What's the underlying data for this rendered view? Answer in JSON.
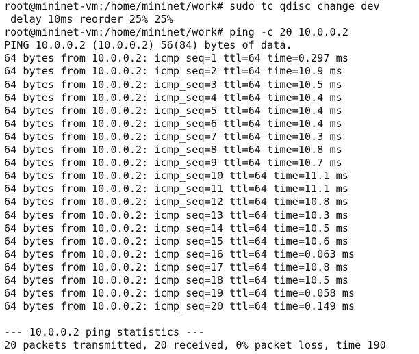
{
  "terminal": {
    "lines": [
      "root@mininet-vm:/home/mininet/work# sudo tc qdisc change dev",
      " delay 10ms reorder 25% 25%",
      "root@mininet-vm:/home/mininet/work# ping -c 20 10.0.0.2",
      "PING 10.0.0.2 (10.0.0.2) 56(84) bytes of data.",
      "64 bytes from 10.0.0.2: icmp_seq=1 ttl=64 time=0.297 ms",
      "64 bytes from 10.0.0.2: icmp_seq=2 ttl=64 time=10.9 ms",
      "64 bytes from 10.0.0.2: icmp_seq=3 ttl=64 time=10.5 ms",
      "64 bytes from 10.0.0.2: icmp_seq=4 ttl=64 time=10.4 ms",
      "64 bytes from 10.0.0.2: icmp_seq=5 ttl=64 time=10.4 ms",
      "64 bytes from 10.0.0.2: icmp_seq=6 ttl=64 time=10.4 ms",
      "64 bytes from 10.0.0.2: icmp_seq=7 ttl=64 time=10.3 ms",
      "64 bytes from 10.0.0.2: icmp_seq=8 ttl=64 time=10.8 ms",
      "64 bytes from 10.0.0.2: icmp_seq=9 ttl=64 time=10.7 ms",
      "64 bytes from 10.0.0.2: icmp_seq=10 ttl=64 time=11.1 ms",
      "64 bytes from 10.0.0.2: icmp_seq=11 ttl=64 time=11.1 ms",
      "64 bytes from 10.0.0.2: icmp_seq=12 ttl=64 time=10.8 ms",
      "64 bytes from 10.0.0.2: icmp_seq=13 ttl=64 time=10.3 ms",
      "64 bytes from 10.0.0.2: icmp_seq=14 ttl=64 time=10.5 ms",
      "64 bytes from 10.0.0.2: icmp_seq=15 ttl=64 time=10.6 ms",
      "64 bytes from 10.0.0.2: icmp_seq=16 ttl=64 time=0.063 ms",
      "64 bytes from 10.0.0.2: icmp_seq=17 ttl=64 time=10.8 ms",
      "64 bytes from 10.0.0.2: icmp_seq=18 ttl=64 time=10.5 ms",
      "64 bytes from 10.0.0.2: icmp_seq=19 ttl=64 time=0.058 ms",
      "64 bytes from 10.0.0.2: icmp_seq=20 ttl=64 time=0.149 ms",
      "",
      "--- 10.0.0.2 ping statistics ---",
      "20 packets transmitted, 20 received, 0% packet loss, time 190"
    ]
  }
}
